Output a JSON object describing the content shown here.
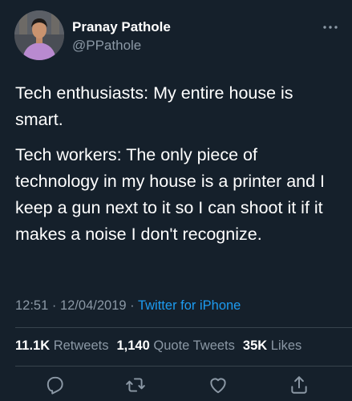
{
  "author": {
    "name": "Pranay Pathole",
    "handle": "@PPathole"
  },
  "tweet": {
    "paragraph_1": "Tech enthusiasts: My entire house is smart.",
    "paragraph_2": "Tech workers: The only piece of technology in my house is a printer and I keep a gun next to it so I can shoot it if it makes a noise I don't recognize."
  },
  "meta": {
    "time": "12:51",
    "date": "12/04/2019",
    "separator": "·",
    "source": "Twitter for iPhone"
  },
  "stats": {
    "retweets_count": "11.1K",
    "retweets_label": "Retweets",
    "quotes_count": "1,140",
    "quotes_label": "Quote Tweets",
    "likes_count": "35K",
    "likes_label": "Likes"
  },
  "actions": {
    "reply_icon": "reply-icon",
    "retweet_icon": "retweet-icon",
    "like_icon": "heart-icon",
    "share_icon": "share-icon"
  },
  "colors": {
    "background": "#15202b",
    "text_primary": "#ffffff",
    "text_secondary": "#8b98a5",
    "link": "#1d9bf0",
    "divider": "#38444d"
  }
}
